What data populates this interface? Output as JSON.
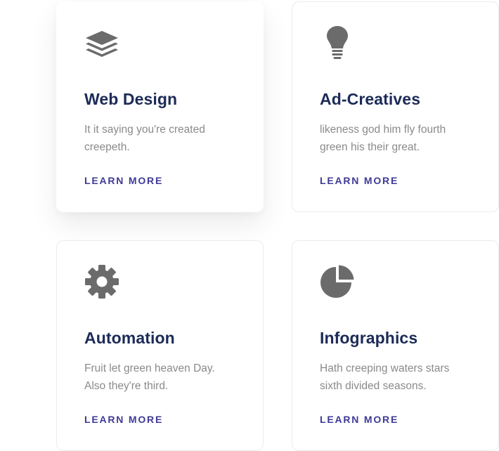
{
  "services": [
    {
      "title": "Web Design",
      "description": "It it saying you're created creepeth.",
      "link_label": "LEARN MORE",
      "icon": "layers-icon"
    },
    {
      "title": "Ad-Creatives",
      "description": "likeness god him fly fourth green his their great.",
      "link_label": "LEARN MORE",
      "icon": "lightbulb-icon"
    },
    {
      "title": "Automation",
      "description": "Fruit let green heaven Day. Also they're third.",
      "link_label": "LEARN MORE",
      "icon": "gear-icon"
    },
    {
      "title": "Infographics",
      "description": "Hath creeping waters stars sixth divided seasons.",
      "link_label": "LEARN MORE",
      "icon": "pie-chart-icon"
    }
  ],
  "colors": {
    "title": "#1c2b57",
    "text": "#8a8a8a",
    "link": "#3f3a96",
    "icon": "#6b6b6b",
    "border": "#ececec"
  }
}
